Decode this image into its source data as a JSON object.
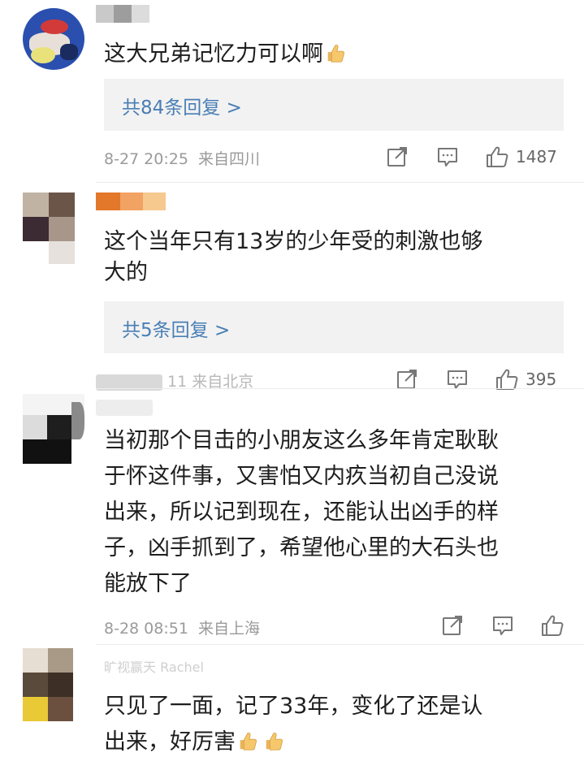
{
  "comments": [
    {
      "text": "这大兄弟记忆力可以啊",
      "emoji": "thumbs-up-icon",
      "replies": "共84条回复 >",
      "time": "8-27 20:25",
      "location": "来自四川",
      "likes": "1487"
    },
    {
      "text_line1": "这个当年只有13岁的少年受的刺激也够",
      "text_line2": "大的",
      "replies": "共5条回复 >",
      "meta_partial": "11 来自北京",
      "likes": "395"
    },
    {
      "lines": [
        "当初那个目击的小朋友这么多年肯定耿耿",
        "于怀这件事，又害怕又内疚当初自己没说",
        "出来，所以记到现在，还能认出凶手的样",
        "子，凶手抓到了，希望他心里的大石头也",
        "能放下了"
      ],
      "time": "8-28 08:51",
      "location": "来自上海"
    },
    {
      "nickname_partial": "旷视赢天 Rachel",
      "line1": "只见了一面，记了33年，变化了还是认",
      "line2": "出来，好厉害",
      "emoji": "thumbs-up-icon"
    }
  ],
  "colors": {
    "reply_link": "#4a7fb5",
    "meta": "#9a9a9a",
    "reply_bg": "#f2f2f2"
  }
}
